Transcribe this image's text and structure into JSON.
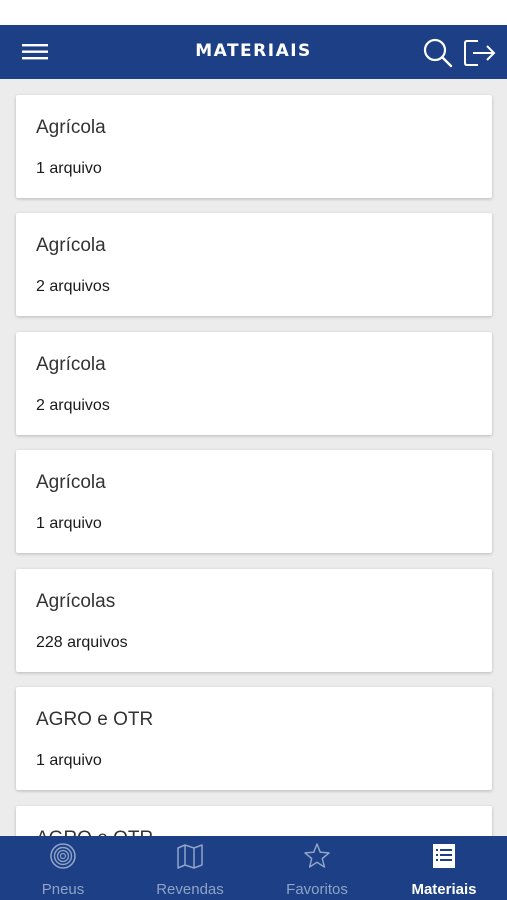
{
  "header": {
    "title": "MATERIAIS",
    "bg_color": "#1c3f85",
    "menu_icon": "hamburger-icon",
    "search_icon": "search-icon",
    "logout_icon": "logout-icon"
  },
  "list": [
    {
      "name": "Agrícola",
      "count": "1 arquivo"
    },
    {
      "name": "Agrícola",
      "count": "2 arquivos"
    },
    {
      "name": "Agrícola",
      "count": "2 arquivos"
    },
    {
      "name": "Agrícola",
      "count": "1 arquivo"
    },
    {
      "name": "Agrícolas",
      "count": "228 arquivos"
    },
    {
      "name": "AGRO e OTR",
      "count": "1 arquivo"
    },
    {
      "name": "AGRO e OTR",
      "count": ""
    }
  ],
  "tabs": [
    {
      "label": "Pneus",
      "icon": "tire-icon",
      "active": false
    },
    {
      "label": "Revendas",
      "icon": "map-icon",
      "active": false
    },
    {
      "label": "Favoritos",
      "icon": "star-icon",
      "active": false
    },
    {
      "label": "Materiais",
      "icon": "list-icon",
      "active": true
    }
  ],
  "colors": {
    "tab_inactive": "#8fa3c8",
    "tab_active": "#ffffff",
    "list_background": "#ececec"
  }
}
